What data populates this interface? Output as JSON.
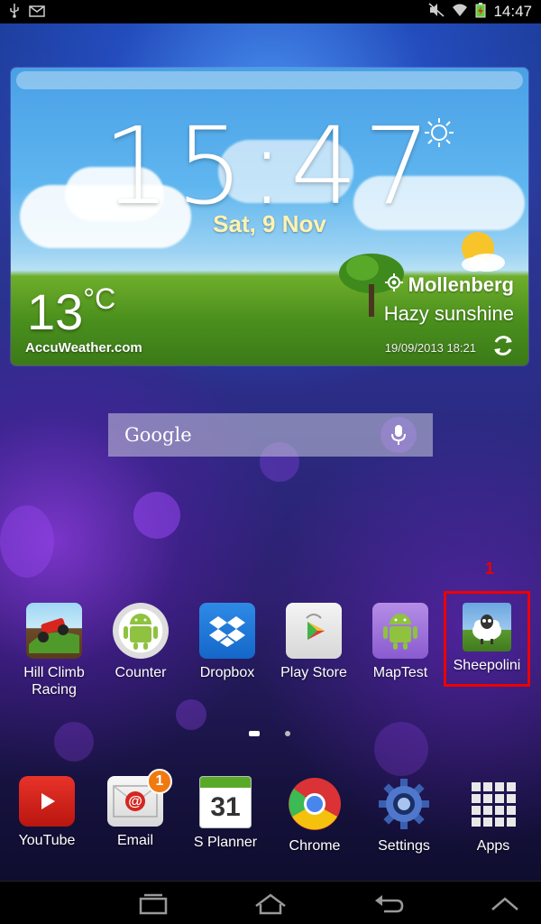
{
  "status_bar": {
    "time": "14:47"
  },
  "weather": {
    "time": "15:47",
    "date": "Sat, 9 Nov",
    "temperature": "13",
    "unit": "°C",
    "location": "Mollenberg",
    "condition": "Hazy sunshine",
    "provider": "AccuWeather.com",
    "updated": "19/09/2013 18:21"
  },
  "search": {
    "label": "Google"
  },
  "apps": [
    {
      "label": "Hill Climb Racing",
      "icon": "hill-climb-racing-icon"
    },
    {
      "label": "Counter",
      "icon": "android-icon"
    },
    {
      "label": "Dropbox",
      "icon": "dropbox-icon"
    },
    {
      "label": "Play Store",
      "icon": "play-store-icon"
    },
    {
      "label": "MapTest",
      "icon": "android-icon"
    },
    {
      "label": "Sheepolini",
      "icon": "sheep-icon"
    }
  ],
  "highlight": {
    "number": "1"
  },
  "dock": [
    {
      "label": "YouTube",
      "icon": "youtube-icon"
    },
    {
      "label": "Email",
      "icon": "email-icon",
      "badge": "1"
    },
    {
      "label": "S Planner",
      "icon": "calendar-icon",
      "day": "31"
    },
    {
      "label": "Chrome",
      "icon": "chrome-icon"
    },
    {
      "label": "Settings",
      "icon": "settings-gear-icon"
    },
    {
      "label": "Apps",
      "icon": "apps-grid-icon"
    }
  ]
}
